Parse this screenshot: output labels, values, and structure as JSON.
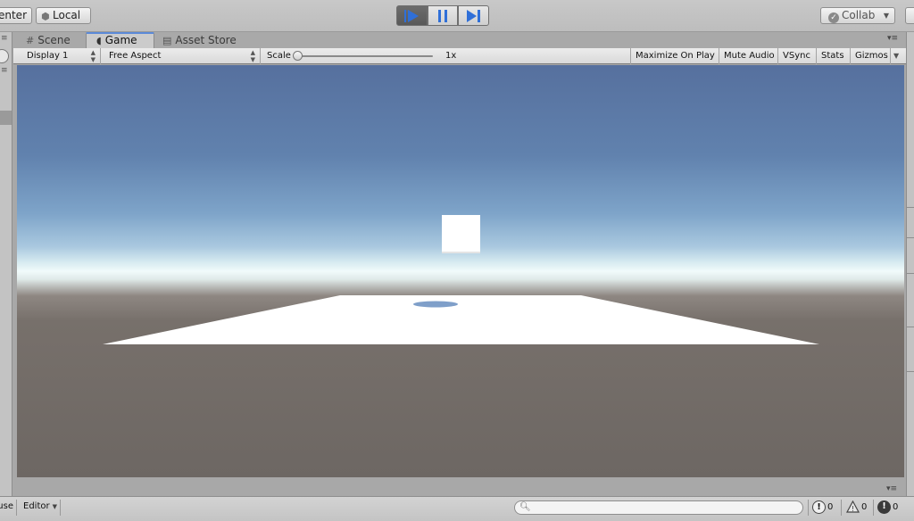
{
  "toolbar": {
    "pivot_label": "Center",
    "space_label": "Local",
    "collab_label": "Collab",
    "accent_color": "#2f6fd8",
    "icons": {
      "space": "cube-icon",
      "play": "play-icon",
      "pause": "pause-icon",
      "step": "step-icon",
      "collab": "check-icon"
    }
  },
  "tabs": [
    {
      "label": "Scene",
      "icon": "grid-icon"
    },
    {
      "label": "Game",
      "icon": "game-icon",
      "active": true
    },
    {
      "label": "Asset Store",
      "icon": "store-icon"
    }
  ],
  "game_controls": {
    "display": "Display 1",
    "aspect": "Free Aspect",
    "scale_label": "Scale",
    "scale_value": "1x",
    "maximize_on_play": "Maximize On Play",
    "mute_audio": "Mute Audio",
    "vsync": "VSync",
    "stats": "Stats",
    "gizmos": "Gizmos"
  },
  "scene": {
    "sky_top_color": "#56709e",
    "horizon_color": "#f1fbfb",
    "ground_color": "#6d6763",
    "plane_color": "#ffffff",
    "cube_color": "#ffffff",
    "shadow_color": "#7f9fc9"
  },
  "statusbar": {
    "pause_label": "Pause",
    "layout_label": "Editor",
    "search_placeholder": "",
    "info_count": "0",
    "warning_count": "0",
    "error_count": "0"
  }
}
